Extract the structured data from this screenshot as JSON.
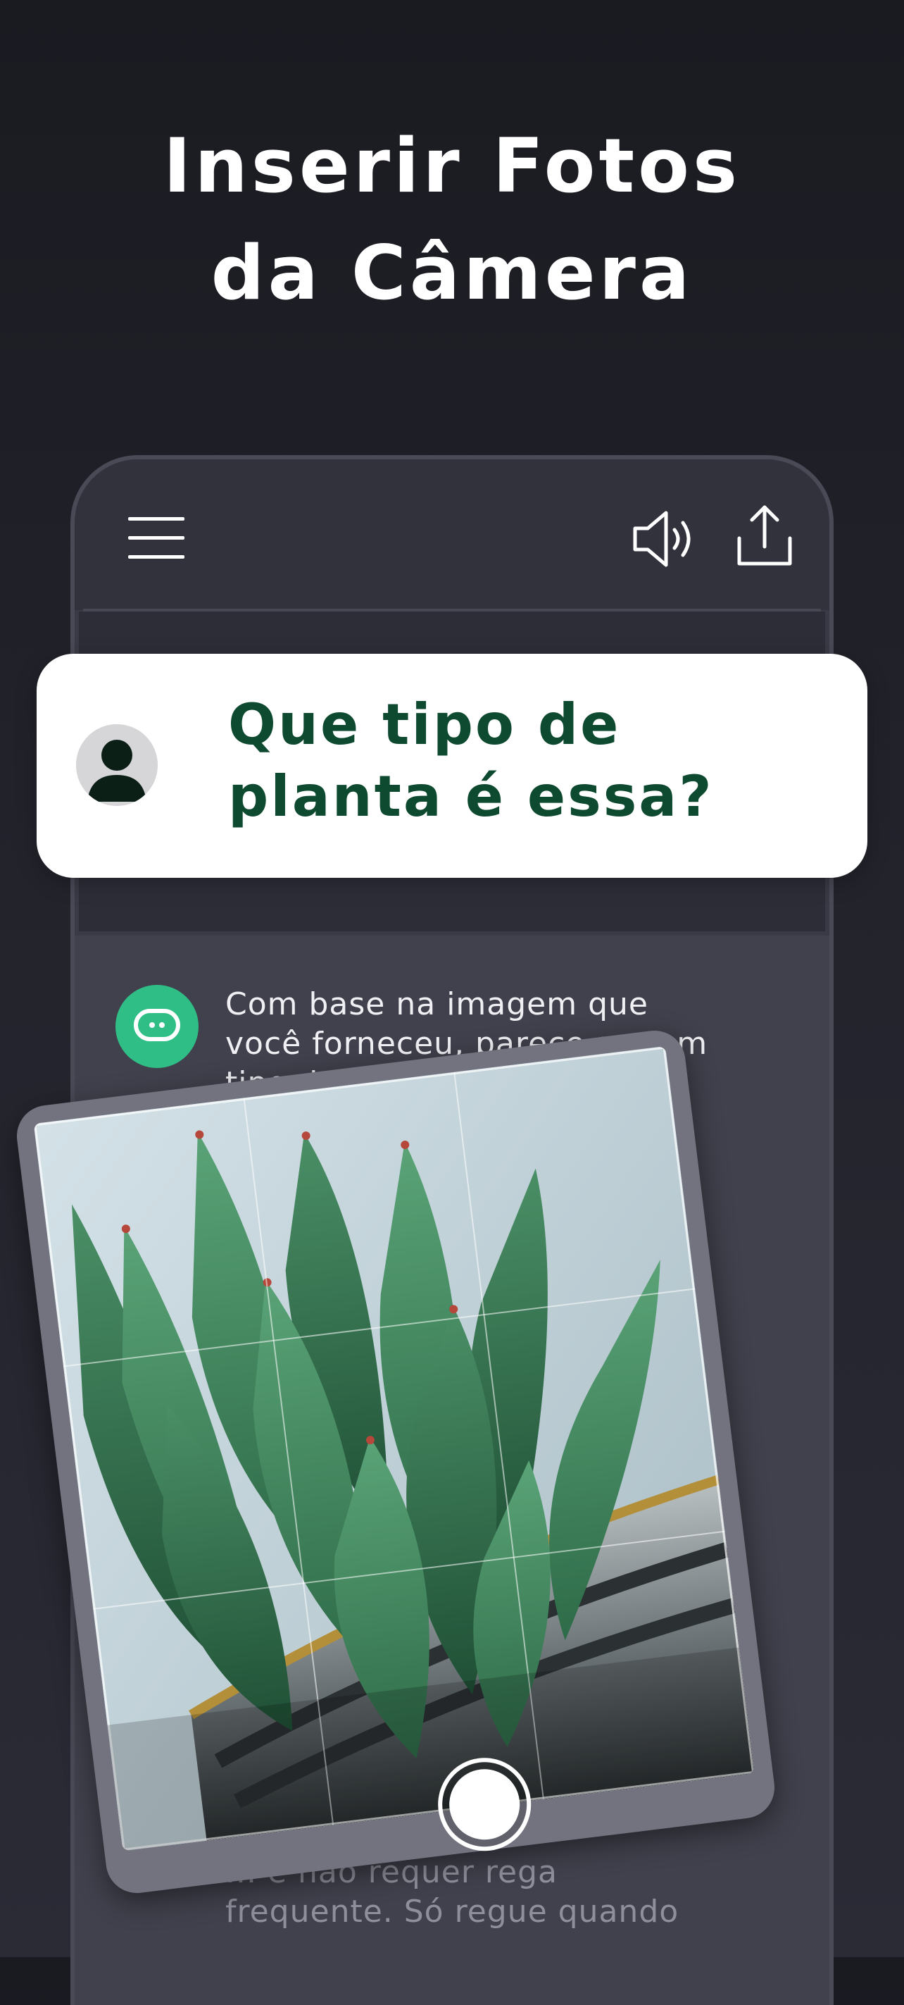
{
  "headline": {
    "line1": "Inserir Fotos",
    "line2": "da Câmera"
  },
  "phone": {
    "topbar": {
      "menu_icon": "hamburger-menu-icon",
      "speaker_icon": "speaker-icon",
      "share_icon": "share-icon"
    },
    "question_bubble": {
      "line1": "Que tipo de",
      "line2": "planta é essa?",
      "avatar_icon": "user-avatar-icon"
    },
    "answer": {
      "bot_icon": "chatbot-icon",
      "line1": "Com base na imagem que",
      "line2": "você forneceu, parece ser um",
      "line3": "tipo de suculenta com",
      "footer_line1": "... e não requer rega",
      "footer_line2": "frequente. Só regue quando"
    },
    "camera": {
      "shutter_icon": "shutter-button-icon"
    }
  },
  "colors": {
    "background": "#1a1a21",
    "bubble_text": "#0e4a2f",
    "bot_green": "#2fbf86"
  }
}
